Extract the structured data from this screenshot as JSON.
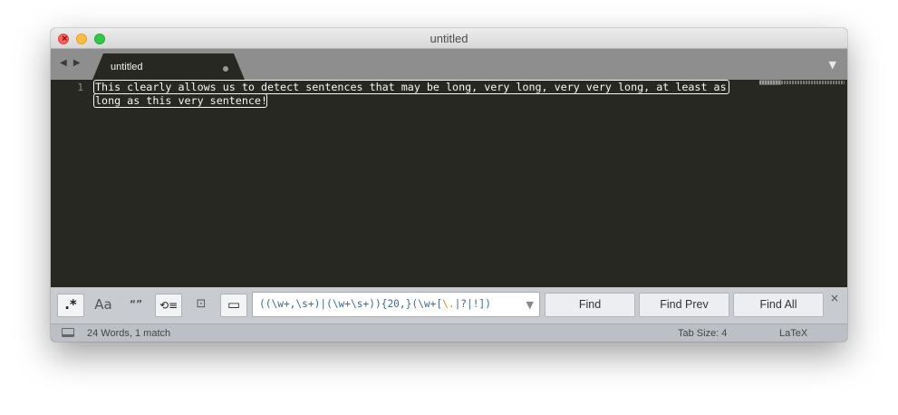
{
  "window": {
    "title": "untitled"
  },
  "tabbar": {
    "nav_arrows": "◀ ▶",
    "tab_label": "untitled",
    "dropdown_icon": "▼"
  },
  "editor": {
    "line_number": "1",
    "lines": [
      "This clearly allows us to detect sentences that may be long, very long, very very long, at least as",
      "long as this very sentence!"
    ]
  },
  "findbar": {
    "options": {
      "regex": ".*",
      "case": "Aa",
      "whole_word": "“”",
      "wrap": "⟲≡",
      "in_selection": "⊡",
      "highlight": "▭"
    },
    "query_part1": "((\\w+,\\s+)|(\\w+\\s+)){20,}(\\w+[",
    "query_part2": "\\.",
    "query_part3": "|?|!])",
    "buttons": {
      "find": "Find",
      "find_prev": "Find Prev",
      "find_all": "Find All"
    },
    "close_icon": "×"
  },
  "statusbar": {
    "info": "24 Words, 1 match",
    "tab_size": "Tab Size: 4",
    "syntax": "LaTeX"
  },
  "colors": {
    "editor_bg": "#272822",
    "tab_bar_bg": "#8e8e8e",
    "find_bar_bg": "#c8cbd0",
    "regex_text": "#3e6a99",
    "regex_accent": "#d48a27"
  }
}
